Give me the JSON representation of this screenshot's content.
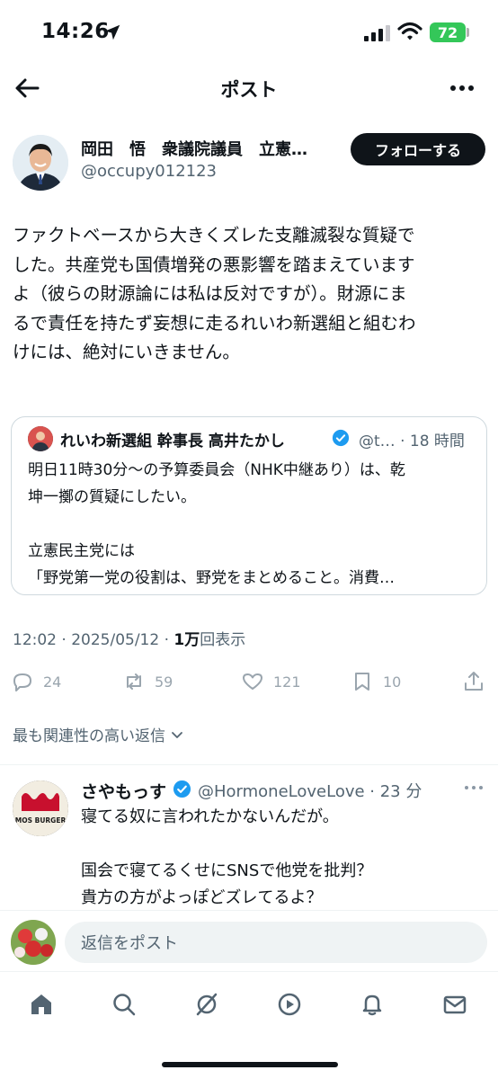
{
  "status_bar": {
    "time": "14:26",
    "battery": "72"
  },
  "header": {
    "title": "ポスト"
  },
  "post": {
    "author_name": "岡田　悟　衆議院議員　立憲…",
    "author_handle": "@occupy012123",
    "follow_label": "フォローする",
    "text_lines": [
      "ファクトベースから大きくズレた支離滅裂な質疑で",
      "した。共産党も国債増発の悪影響を踏まえています",
      "よ（彼らの財源論には私は反対ですが）。財源にま",
      "るで責任を持たず妄想に走るれいわ新選組と組むわ",
      "けには、絶対にいきません。"
    ],
    "timestamp": "12:02 · 2025/05/12 · ",
    "views_count": "1万",
    "views_label": "回表示",
    "actions": {
      "replies": "24",
      "reposts": "59",
      "likes": "121",
      "bookmarks": "10"
    }
  },
  "quote": {
    "author_name": "れいわ新選組 幹事長 高井たかし",
    "author_handle": "@t… · 18 時間",
    "text_lines": [
      "明日11時30分〜の予算委員会（NHK中継あり）は、乾",
      "坤一擲の質疑にしたい。",
      "",
      "立憲民主党には",
      "「野党第一党の役割は、野党をまとめること。消費…"
    ]
  },
  "replies_filter": "最も関連性の高い返信",
  "reply": {
    "avatar_text": "MOS BURGER",
    "author_name": "さやもっす",
    "author_handle": "@HormoneLoveLove · 23 分",
    "text_lines": [
      "寝てる奴に言われたかないんだが。",
      "",
      "国会で寝てるくせにSNSで他党を批判？",
      "貴方の方がよっぽどズレてるよ？"
    ]
  },
  "composer": {
    "placeholder": "返信をポスト"
  },
  "tabs": [
    "home",
    "search",
    "grok",
    "media",
    "notifications",
    "messages"
  ],
  "colors": {
    "verified": "#1d9bf0",
    "battery": "#34c759",
    "text": "#0f1419",
    "secondary": "#536471"
  },
  "icons": [
    "location-arrow-icon",
    "signal-icon",
    "wifi-icon",
    "back-arrow-icon",
    "more-icon",
    "verified-icon",
    "reply-icon",
    "repost-icon",
    "like-icon",
    "bookmark-icon",
    "share-icon",
    "chevron-down-icon",
    "home-icon",
    "search-icon",
    "grok-icon",
    "play-icon",
    "bell-icon",
    "mail-icon"
  ]
}
